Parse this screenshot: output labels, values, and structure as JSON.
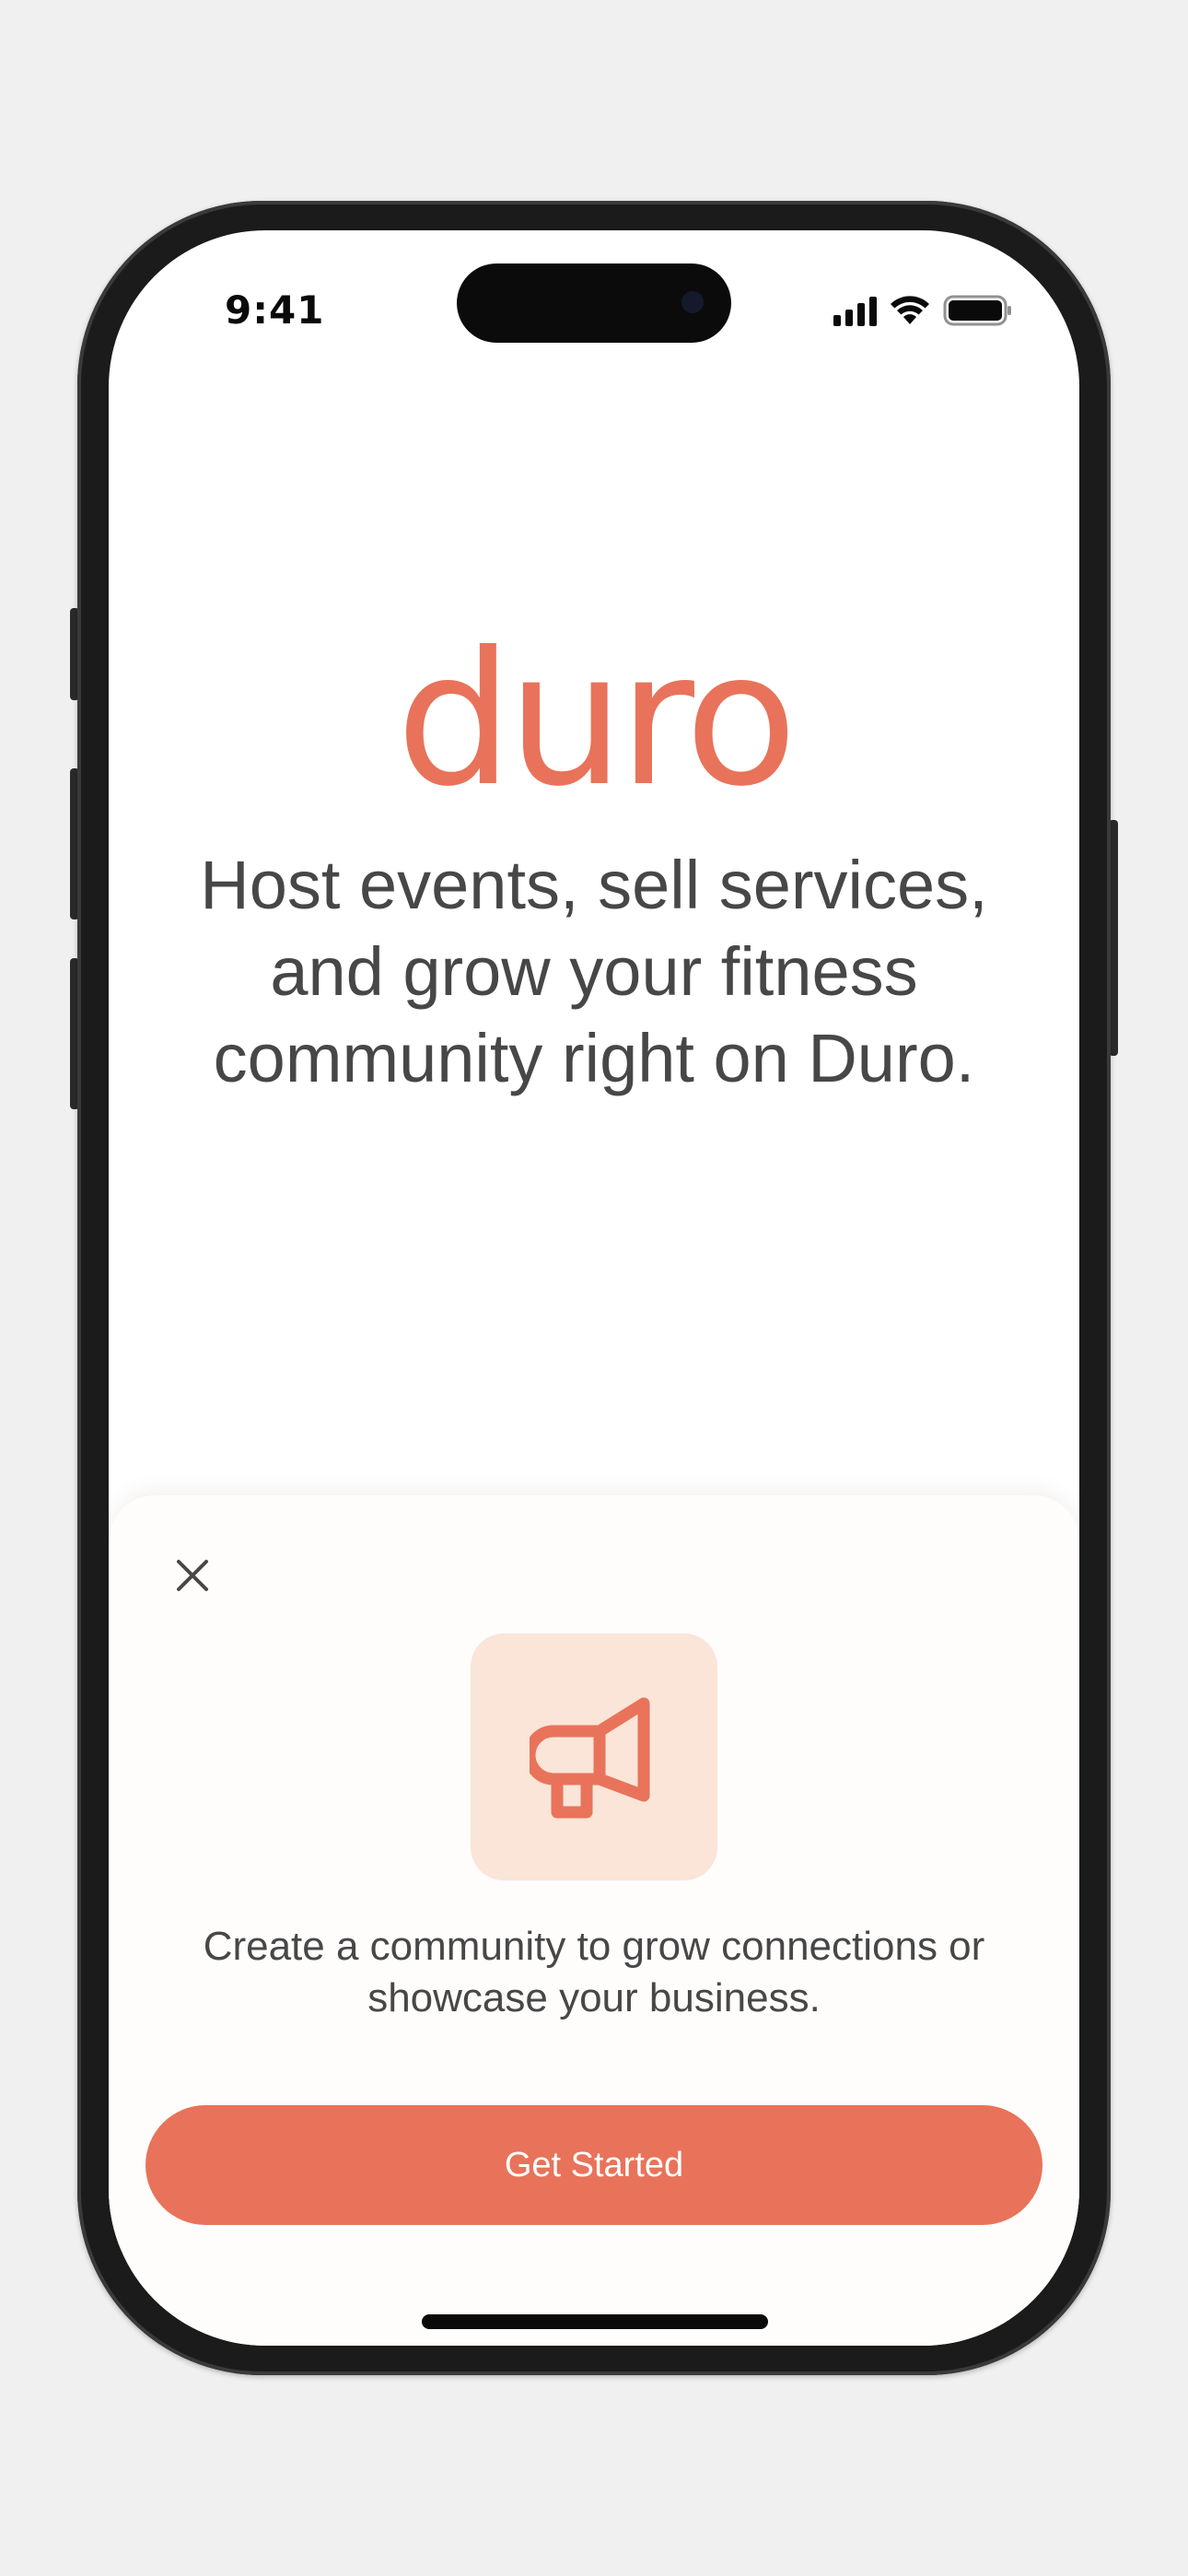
{
  "status_bar": {
    "time": "9:41",
    "icons": [
      "cellular-signal-icon",
      "wifi-icon",
      "battery-icon"
    ]
  },
  "brand": {
    "logo_text": "duro",
    "tagline": "Host events, sell services, and grow your fitness community right on Duro.",
    "accent_color": "#e8735a"
  },
  "sheet": {
    "close_icon": "close-icon",
    "feature_icon": "megaphone-icon",
    "description": "Create a community to grow connections or showcase your business.",
    "cta_label": "Get Started",
    "tile_color": "#fae5d8"
  }
}
